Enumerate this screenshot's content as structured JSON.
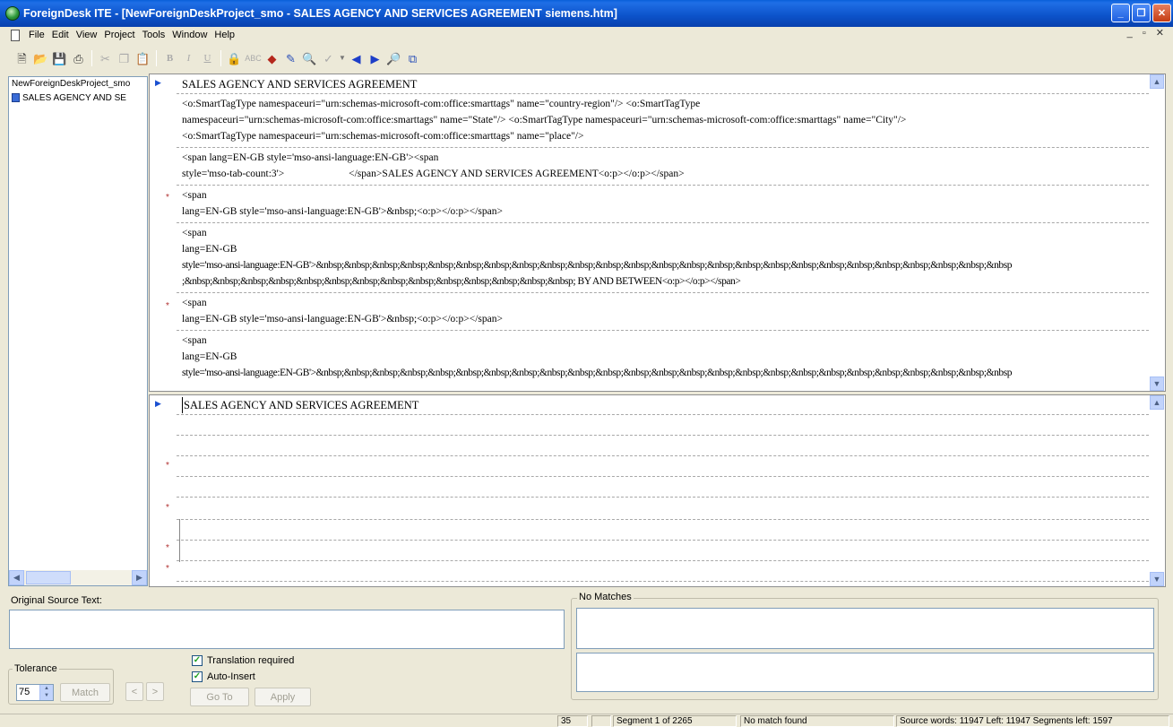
{
  "window": {
    "title": "ForeignDesk ITE - [NewForeignDeskProject_smo - SALES AGENCY AND SERVICES AGREEMENT siemens.htm]"
  },
  "menubar": [
    "File",
    "Edit",
    "View",
    "Project",
    "Tools",
    "Window",
    "Help"
  ],
  "toolbar": {
    "icons": [
      "new-icon",
      "open-icon",
      "save-icon",
      "print-icon",
      "cut-icon",
      "copy-icon",
      "paste-icon",
      "bold-icon",
      "italic-icon",
      "underline-icon",
      "lock-icon",
      "abc-icon",
      "tag-icon",
      "edit-icon",
      "find-icon",
      "spellcheck-icon",
      "prev-icon",
      "next-icon",
      "preview-icon",
      "compare-icon"
    ]
  },
  "tree": {
    "project": "NewForeignDeskProject_smo",
    "document": "SALES AGENCY AND SE"
  },
  "source_pane": {
    "lines": [
      "SALES AGENCY AND SERVICES AGREEMENT",
      " <o:SmartTagType namespaceuri=\"urn:schemas-microsoft-com:office:smarttags\" name=\"country-region\"/> <o:SmartTagType",
      "namespaceuri=\"urn:schemas-microsoft-com:office:smarttags\" name=\"State\"/> <o:SmartTagType namespaceuri=\"urn:schemas-microsoft-com:office:smarttags\" name=\"City\"/>",
      "<o:SmartTagType namespaceuri=\"urn:schemas-microsoft-com:office:smarttags\" name=\"place\"/>",
      "<span lang=EN-GB style='mso-ansi-language:EN-GB'><span",
      "style='mso-tab-count:3'>                         </span>SALES AGENCY AND SERVICES AGREEMENT<o:p></o:p></span>",
      "<span",
      "lang=EN-GB style='mso-ansi-language:EN-GB'>&nbsp;<o:p></o:p></span>",
      "<span",
      "lang=EN-GB",
      "style='mso-ansi-language:EN-GB'>&nbsp;&nbsp;&nbsp;&nbsp;&nbsp;&nbsp;&nbsp;&nbsp;&nbsp;&nbsp;&nbsp;&nbsp;&nbsp;&nbsp;&nbsp;&nbsp;&nbsp;&nbsp;&nbsp;&nbsp;&nbsp;&nbsp;&nbsp;&nbsp;&nbsp",
      ";&nbsp;&nbsp;&nbsp;&nbsp;&nbsp;&nbsp;&nbsp;&nbsp;&nbsp;&nbsp;&nbsp;&nbsp;&nbsp;&nbsp; BY AND BETWEEN<o:p></o:p></span>",
      "<span",
      "lang=EN-GB style='mso-ansi-language:EN-GB'>&nbsp;<o:p></o:p></span>",
      "<span",
      "lang=EN-GB",
      "style='mso-ansi-language:EN-GB'>&nbsp;&nbsp;&nbsp;&nbsp;&nbsp;&nbsp;&nbsp;&nbsp;&nbsp;&nbsp;&nbsp;&nbsp;&nbsp;&nbsp;&nbsp;&nbsp;&nbsp;&nbsp;&nbsp;&nbsp;&nbsp;&nbsp;&nbsp;&nbsp;&nbsp"
    ]
  },
  "target_pane": {
    "first_segment": "SALES AGENCY AND SERVICES AGREEMENT"
  },
  "bottom": {
    "original_source_label": "Original Source Text:",
    "matches_label": "No Matches",
    "tolerance_label": "Tolerance",
    "tolerance_value": "75",
    "match_button": "Match",
    "prev_button": "<",
    "next_button": ">",
    "translation_required": "Translation required",
    "auto_insert": "Auto-Insert",
    "goto_button": "Go To",
    "apply_button": "Apply"
  },
  "status": {
    "col1": "35",
    "segment": "Segment 1 of 2265",
    "match": "No match found",
    "words": "Source words: 11947  Left: 11947  Segments left: 1597"
  }
}
